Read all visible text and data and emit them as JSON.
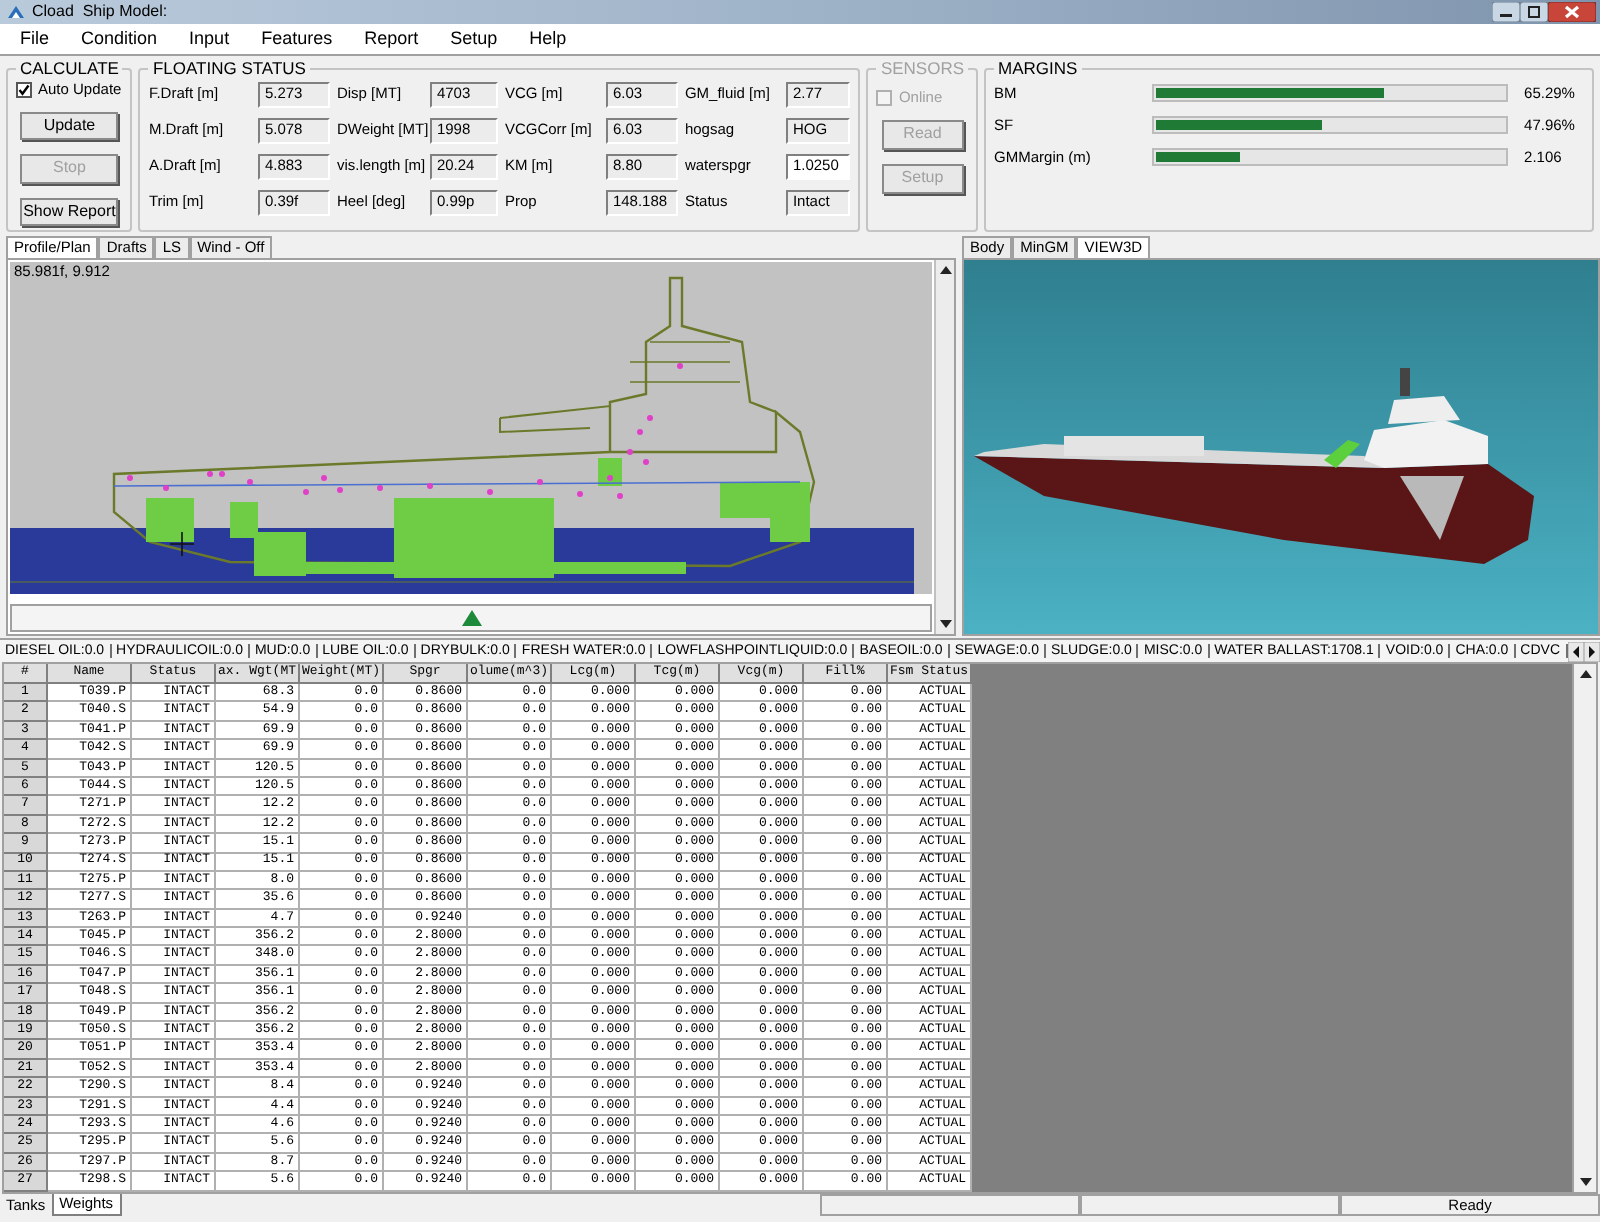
{
  "window": {
    "title": "Cload  Ship Model:"
  },
  "menu": [
    "File",
    "Condition",
    "Input",
    "Features",
    "Report",
    "Setup",
    "Help"
  ],
  "calculate": {
    "title": "CALCULATE",
    "auto_update": {
      "label": "Auto Update",
      "checked": true
    },
    "buttons": [
      {
        "label": "Update",
        "disabled": false
      },
      {
        "label": "Stop",
        "disabled": true
      },
      {
        "label": "Show Report",
        "disabled": false
      }
    ]
  },
  "floating_status": {
    "title": "FLOATING STATUS",
    "fields": [
      {
        "label": "F.Draft [m]",
        "value": "5.273",
        "editable": false
      },
      {
        "label": "Disp [MT]",
        "value": "4703",
        "editable": false
      },
      {
        "label": "VCG [m]",
        "value": "6.03",
        "editable": false
      },
      {
        "label": "GM_fluid [m]",
        "value": "2.77",
        "editable": false
      },
      {
        "label": "M.Draft [m]",
        "value": "5.078",
        "editable": false
      },
      {
        "label": "DWeight [MT]",
        "value": "1998",
        "editable": false
      },
      {
        "label": "VCGCorr [m]",
        "value": "6.03",
        "editable": false
      },
      {
        "label": "hogsag",
        "value": "HOG",
        "editable": false
      },
      {
        "label": "A.Draft [m]",
        "value": "4.883",
        "editable": false
      },
      {
        "label": "vis.length [m]",
        "value": "20.24",
        "editable": false
      },
      {
        "label": "KM [m]",
        "value": "8.80",
        "editable": false
      },
      {
        "label": "waterspgr",
        "value": "1.0250",
        "editable": true
      },
      {
        "label": "Trim [m]",
        "value": "0.39f",
        "editable": false
      },
      {
        "label": "Heel [deg]",
        "value": "0.99p",
        "editable": false
      },
      {
        "label": "Prop",
        "value": "148.188",
        "editable": false
      },
      {
        "label": "Status",
        "value": "Intact",
        "editable": false
      }
    ]
  },
  "sensors": {
    "title": "SENSORS",
    "disabled": true,
    "online": {
      "label": "Online",
      "checked": false
    },
    "buttons": [
      "Read",
      "Setup"
    ]
  },
  "margins": {
    "title": "MARGINS",
    "items": [
      {
        "label": "BM",
        "level": 0.6529,
        "reading": "65.29%"
      },
      {
        "label": "SF",
        "level": 0.4796,
        "reading": "47.96%"
      },
      {
        "label": "GMMargin (m)",
        "level": 0.24,
        "reading": "2.106"
      }
    ]
  },
  "view_tabs": [
    {
      "label": "Profile/Plan",
      "selected": true
    },
    {
      "label": "Drafts",
      "selected": false
    },
    {
      "label": "LS",
      "selected": false
    },
    {
      "label": "Wind - Off",
      "selected": false
    }
  ],
  "profile": {
    "coordinates": "85.981f, 9.912"
  },
  "view3d_tabs": [
    {
      "label": "Body",
      "selected": false
    },
    {
      "label": "MinGM",
      "selected": false
    },
    {
      "label": "VIEW3D",
      "selected": true
    }
  ],
  "categories": [
    "DIESEL OIL:0.0",
    "HYDRAULICOIL:0.0",
    "MUD:0.0",
    "LUBE OIL:0.0",
    "DRYBULK:0.0",
    "FRESH WATER:0.0",
    "LOWFLASHPOINTLIQUID:0.0",
    "BASEOIL:0.0",
    "SEWAGE:0.0",
    "SLUDGE:0.0",
    "MISC:0.0",
    "WATER BALLAST:1708.1",
    "VOID:0.0",
    "CHA:0.0",
    "CDVC"
  ],
  "table": {
    "columns": [
      "#",
      "Name",
      "Status",
      "ax. Wgt(MT",
      "Weight(MT)",
      "Spgr",
      "olume(m^3)",
      "Lcg(m)",
      "Tcg(m)",
      "Vcg(m)",
      "Fill%",
      "Fsm Status"
    ],
    "rows": [
      [
        "1",
        "T039.P",
        "INTACT",
        "68.3",
        "0.0",
        "0.8600",
        "0.0",
        "0.000",
        "0.000",
        "0.000",
        "0.00",
        "ACTUAL"
      ],
      [
        "2",
        "T040.S",
        "INTACT",
        "54.9",
        "0.0",
        "0.8600",
        "0.0",
        "0.000",
        "0.000",
        "0.000",
        "0.00",
        "ACTUAL"
      ],
      [
        "3",
        "T041.P",
        "INTACT",
        "69.9",
        "0.0",
        "0.8600",
        "0.0",
        "0.000",
        "0.000",
        "0.000",
        "0.00",
        "ACTUAL"
      ],
      [
        "4",
        "T042.S",
        "INTACT",
        "69.9",
        "0.0",
        "0.8600",
        "0.0",
        "0.000",
        "0.000",
        "0.000",
        "0.00",
        "ACTUAL"
      ],
      [
        "5",
        "T043.P",
        "INTACT",
        "120.5",
        "0.0",
        "0.8600",
        "0.0",
        "0.000",
        "0.000",
        "0.000",
        "0.00",
        "ACTUAL"
      ],
      [
        "6",
        "T044.S",
        "INTACT",
        "120.5",
        "0.0",
        "0.8600",
        "0.0",
        "0.000",
        "0.000",
        "0.000",
        "0.00",
        "ACTUAL"
      ],
      [
        "7",
        "T271.P",
        "INTACT",
        "12.2",
        "0.0",
        "0.8600",
        "0.0",
        "0.000",
        "0.000",
        "0.000",
        "0.00",
        "ACTUAL"
      ],
      [
        "8",
        "T272.S",
        "INTACT",
        "12.2",
        "0.0",
        "0.8600",
        "0.0",
        "0.000",
        "0.000",
        "0.000",
        "0.00",
        "ACTUAL"
      ],
      [
        "9",
        "T273.P",
        "INTACT",
        "15.1",
        "0.0",
        "0.8600",
        "0.0",
        "0.000",
        "0.000",
        "0.000",
        "0.00",
        "ACTUAL"
      ],
      [
        "10",
        "T274.S",
        "INTACT",
        "15.1",
        "0.0",
        "0.8600",
        "0.0",
        "0.000",
        "0.000",
        "0.000",
        "0.00",
        "ACTUAL"
      ],
      [
        "11",
        "T275.P",
        "INTACT",
        "8.0",
        "0.0",
        "0.8600",
        "0.0",
        "0.000",
        "0.000",
        "0.000",
        "0.00",
        "ACTUAL"
      ],
      [
        "12",
        "T277.S",
        "INTACT",
        "35.6",
        "0.0",
        "0.8600",
        "0.0",
        "0.000",
        "0.000",
        "0.000",
        "0.00",
        "ACTUAL"
      ],
      [
        "13",
        "T263.P",
        "INTACT",
        "4.7",
        "0.0",
        "0.9240",
        "0.0",
        "0.000",
        "0.000",
        "0.000",
        "0.00",
        "ACTUAL"
      ],
      [
        "14",
        "T045.P",
        "INTACT",
        "356.2",
        "0.0",
        "2.8000",
        "0.0",
        "0.000",
        "0.000",
        "0.000",
        "0.00",
        "ACTUAL"
      ],
      [
        "15",
        "T046.S",
        "INTACT",
        "348.0",
        "0.0",
        "2.8000",
        "0.0",
        "0.000",
        "0.000",
        "0.000",
        "0.00",
        "ACTUAL"
      ],
      [
        "16",
        "T047.P",
        "INTACT",
        "356.1",
        "0.0",
        "2.8000",
        "0.0",
        "0.000",
        "0.000",
        "0.000",
        "0.00",
        "ACTUAL"
      ],
      [
        "17",
        "T048.S",
        "INTACT",
        "356.1",
        "0.0",
        "2.8000",
        "0.0",
        "0.000",
        "0.000",
        "0.000",
        "0.00",
        "ACTUAL"
      ],
      [
        "18",
        "T049.P",
        "INTACT",
        "356.2",
        "0.0",
        "2.8000",
        "0.0",
        "0.000",
        "0.000",
        "0.000",
        "0.00",
        "ACTUAL"
      ],
      [
        "19",
        "T050.S",
        "INTACT",
        "356.2",
        "0.0",
        "2.8000",
        "0.0",
        "0.000",
        "0.000",
        "0.000",
        "0.00",
        "ACTUAL"
      ],
      [
        "20",
        "T051.P",
        "INTACT",
        "353.4",
        "0.0",
        "2.8000",
        "0.0",
        "0.000",
        "0.000",
        "0.000",
        "0.00",
        "ACTUAL"
      ],
      [
        "21",
        "T052.S",
        "INTACT",
        "353.4",
        "0.0",
        "2.8000",
        "0.0",
        "0.000",
        "0.000",
        "0.000",
        "0.00",
        "ACTUAL"
      ],
      [
        "22",
        "T290.S",
        "INTACT",
        "8.4",
        "0.0",
        "0.9240",
        "0.0",
        "0.000",
        "0.000",
        "0.000",
        "0.00",
        "ACTUAL"
      ],
      [
        "23",
        "T291.S",
        "INTACT",
        "4.4",
        "0.0",
        "0.9240",
        "0.0",
        "0.000",
        "0.000",
        "0.000",
        "0.00",
        "ACTUAL"
      ],
      [
        "24",
        "T293.S",
        "INTACT",
        "4.6",
        "0.0",
        "0.9240",
        "0.0",
        "0.000",
        "0.000",
        "0.000",
        "0.00",
        "ACTUAL"
      ],
      [
        "25",
        "T295.P",
        "INTACT",
        "5.6",
        "0.0",
        "0.9240",
        "0.0",
        "0.000",
        "0.000",
        "0.000",
        "0.00",
        "ACTUAL"
      ],
      [
        "26",
        "T297.P",
        "INTACT",
        "8.7",
        "0.0",
        "0.9240",
        "0.0",
        "0.000",
        "0.000",
        "0.000",
        "0.00",
        "ACTUAL"
      ],
      [
        "27",
        "T298.S",
        "INTACT",
        "5.6",
        "0.0",
        "0.9240",
        "0.0",
        "0.000",
        "0.000",
        "0.000",
        "0.00",
        "ACTUAL"
      ]
    ]
  },
  "bottom_tabs": [
    {
      "label": "Tanks",
      "selected": false
    },
    {
      "label": "Weights",
      "selected": true
    }
  ],
  "status_bar": {
    "text": "Ready"
  }
}
